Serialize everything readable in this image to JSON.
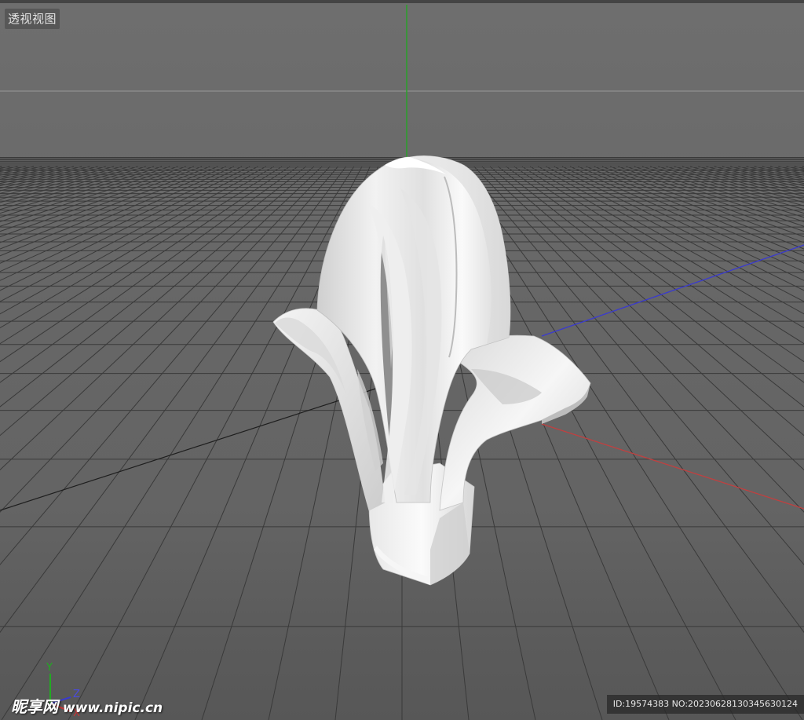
{
  "viewport": {
    "label": "透视视图",
    "axis_colors": {
      "x": "#c04040",
      "y": "#2aa02a",
      "z": "#3a3ad0"
    },
    "gizmo_labels": {
      "y": "Y",
      "z": "Z",
      "x": "X"
    }
  },
  "watermark": {
    "brand": "昵享网",
    "url": "www.nipic.cn",
    "image_id": "ID:19574383 NO:20230628130345630124"
  },
  "scene": {
    "object": "white-ornamental-leaf-model",
    "object_color": "#e6e6e6",
    "grid_color": "#3a3a3a"
  }
}
